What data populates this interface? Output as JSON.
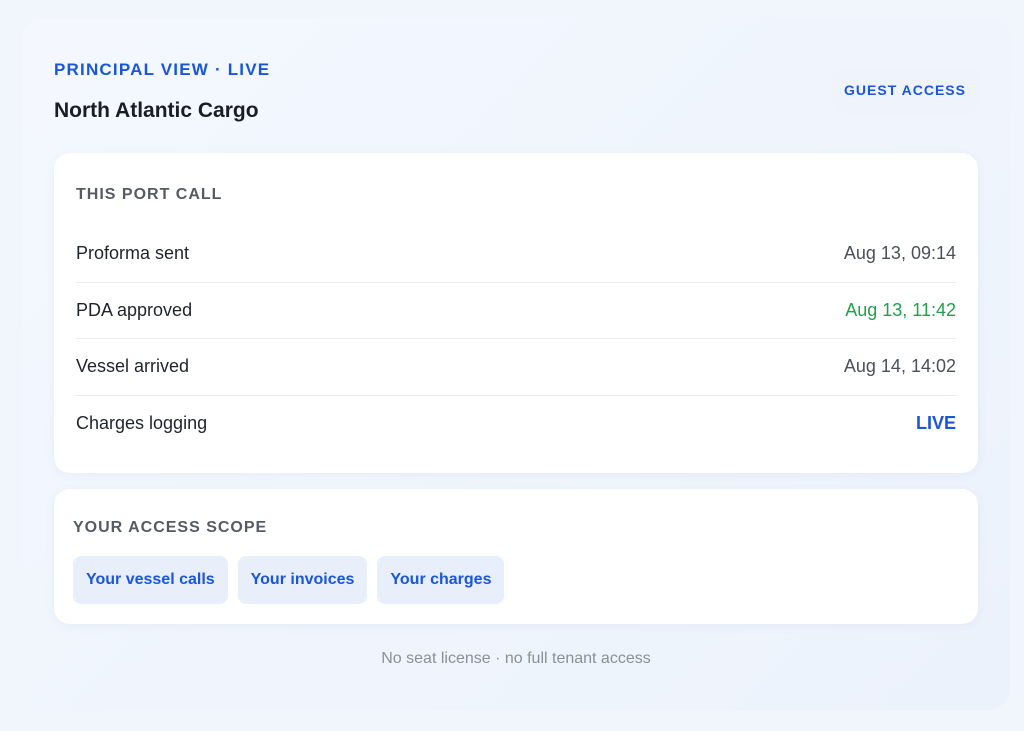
{
  "header": {
    "eyebrow": "PRINCIPAL VIEW · LIVE",
    "title": "North Atlantic Cargo",
    "badge": "GUEST ACCESS"
  },
  "port_call": {
    "title": "THIS PORT CALL",
    "rows": [
      {
        "label": "Proforma sent",
        "value": "Aug 13, 09:14",
        "status": "neutral"
      },
      {
        "label": "PDA approved",
        "value": "Aug 13, 11:42",
        "status": "success"
      },
      {
        "label": "Vessel arrived",
        "value": "Aug 14, 14:02",
        "status": "neutral"
      },
      {
        "label": "Charges logging",
        "value": "LIVE",
        "status": "live"
      }
    ]
  },
  "access_scope": {
    "title": "YOUR ACCESS SCOPE",
    "chips": [
      {
        "label": "Your vessel calls"
      },
      {
        "label": "Your invoices"
      },
      {
        "label": "Your charges"
      }
    ]
  },
  "footnote": "No seat license · no full tenant access",
  "colors": {
    "accent": "#1a56db",
    "success": "#22a04b",
    "background": "#f1f5fc"
  }
}
